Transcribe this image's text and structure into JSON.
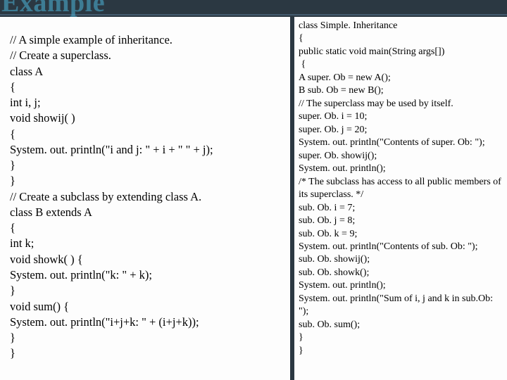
{
  "title": "Example",
  "left": [
    "// A simple example of inheritance.",
    "// Create a superclass.",
    "class A",
    "{",
    "int i, j;",
    "void showij( )",
    "{",
    "System. out. println(\"i and j: \" + i + \" \" + j);",
    "}",
    "}",
    "// Create a subclass by extending class A.",
    "class B extends A",
    "{",
    "int k;",
    "void showk( ) {",
    "System. out. println(\"k: \" + k);",
    "}",
    "void sum() {",
    "System. out. println(\"i+j+k: \" + (i+j+k));",
    "}",
    "}"
  ],
  "right": [
    "class Simple. Inheritance",
    "{",
    "public static void main(String args[])",
    " {",
    "A super. Ob = new A();",
    "B sub. Ob = new B();",
    "// The superclass may be used by itself.",
    "super. Ob. i = 10;",
    "super. Ob. j = 20;",
    "System. out. println(\"Contents of super. Ob: \");",
    "super. Ob. showij();",
    "System. out. println();",
    "/* The subclass has access to all public members of",
    "its superclass. */",
    "sub. Ob. i = 7;",
    "sub. Ob. j = 8;",
    "sub. Ob. k = 9;",
    "System. out. println(\"Contents of sub. Ob: \");",
    "sub. Ob. showij();",
    "sub. Ob. showk();",
    "System. out. println();",
    "System. out. println(\"Sum of i, j and k in sub.Ob: \");",
    "sub. Ob. sum();",
    "}",
    "}"
  ]
}
